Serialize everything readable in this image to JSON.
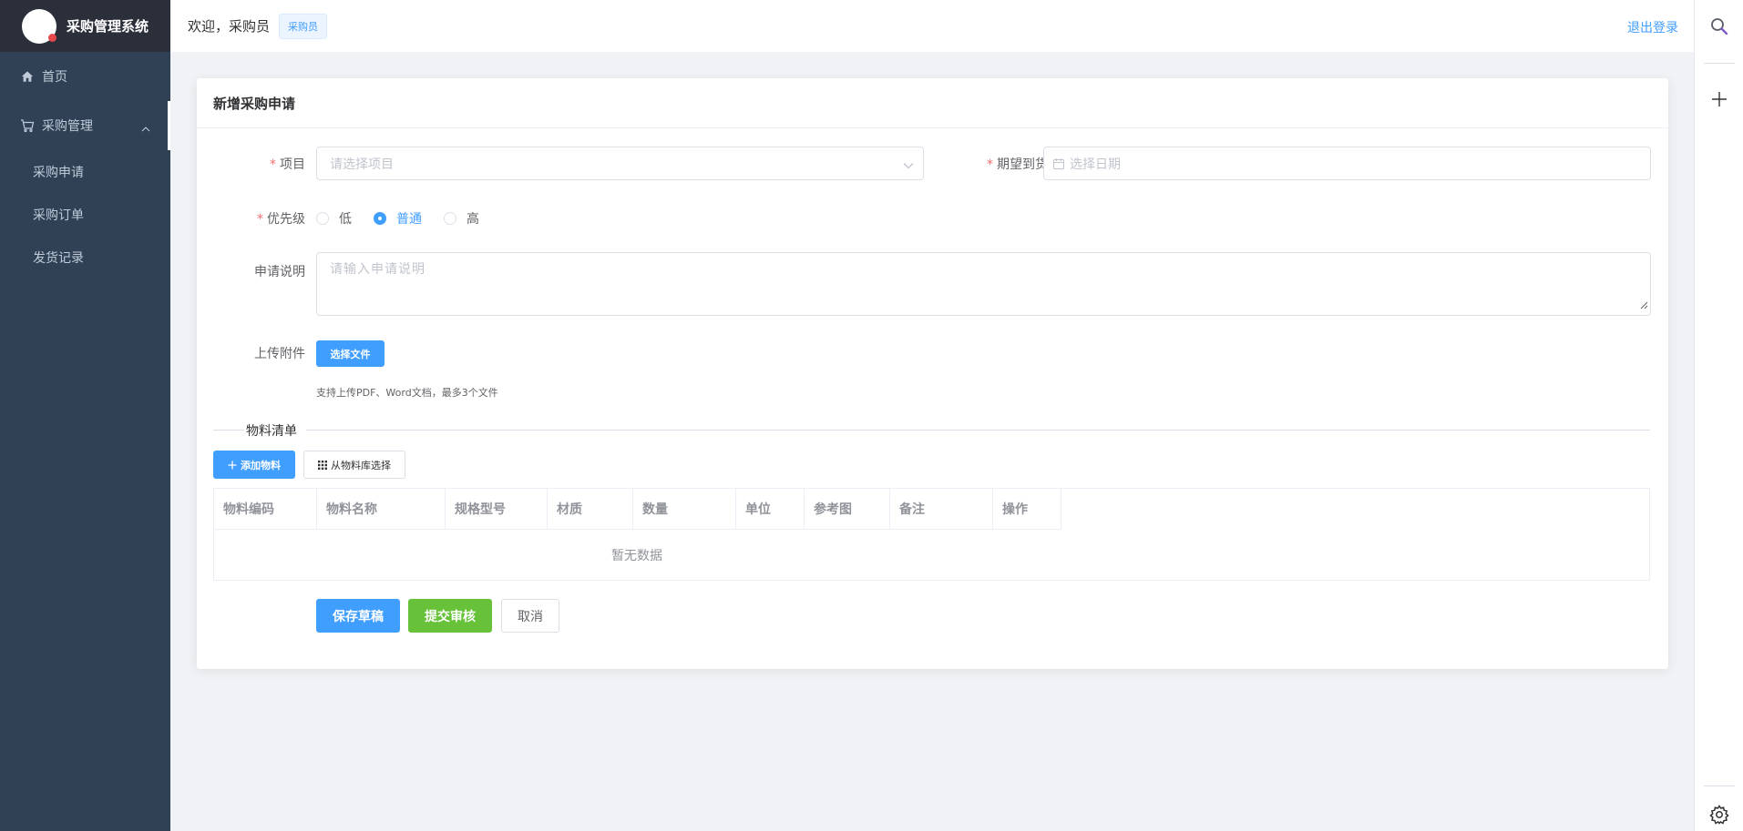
{
  "sidebar": {
    "app_title": "采购管理系统",
    "menu": [
      {
        "label": "首页",
        "icon": "home-icon"
      },
      {
        "label": "采购管理",
        "icon": "cart-icon",
        "expanded": true
      }
    ],
    "sub_items": [
      {
        "label": "采购申请"
      },
      {
        "label": "采购订单"
      },
      {
        "label": "发货记录"
      }
    ]
  },
  "header": {
    "welcome": "欢迎，采购员",
    "role_tag": "采购员",
    "logout": "退出登录"
  },
  "right_tools": [
    "search-icon",
    "plus-icon",
    "gear-icon"
  ],
  "form": {
    "title": "新增采购申请",
    "project": {
      "label": "项目",
      "required": true,
      "placeholder": "请选择项目"
    },
    "expected_date": {
      "label": "期望到货日",
      "required": true,
      "placeholder": "选择日期"
    },
    "priority": {
      "label": "优先级",
      "required": true,
      "options": [
        "低",
        "普通",
        "高"
      ],
      "selected": "普通"
    },
    "description": {
      "label": "申请说明",
      "placeholder": "请输入申请说明"
    },
    "attachment": {
      "label": "上传附件",
      "button": "选择文件",
      "hint": "支持上传PDF、Word文档，最多3个文件"
    },
    "materials": {
      "section_title": "物料清单",
      "add_button": "添加物料",
      "library_button": "从物料库选择",
      "columns": [
        "物料编码",
        "物料名称",
        "规格型号",
        "材质",
        "数量",
        "单位",
        "参考图",
        "备注",
        "操作"
      ],
      "empty_text": "暂无数据"
    },
    "actions": {
      "save_draft": "保存草稿",
      "submit": "提交审核",
      "cancel": "取消"
    }
  },
  "colors": {
    "sidebar_bg": "#304156",
    "logo_bg": "#2b2f3a",
    "primary": "#409eff",
    "success": "#67c23a",
    "required": "#f56c6c"
  }
}
